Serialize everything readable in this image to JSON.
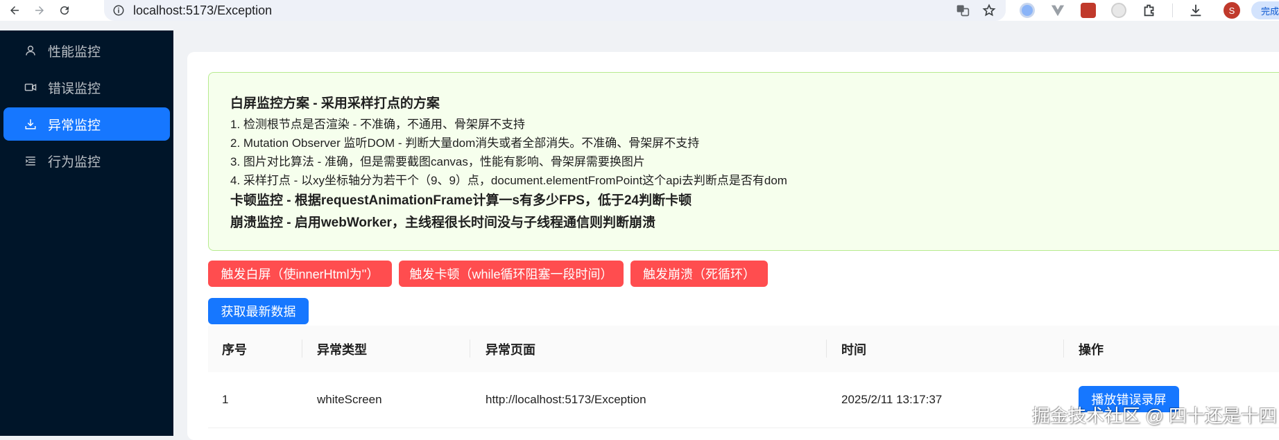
{
  "browser": {
    "url": "localhost:5173/Exception",
    "avatar_letter": "S",
    "finish_label": "完成"
  },
  "sidebar": {
    "items": [
      {
        "label": "性能监控",
        "icon": "user-icon",
        "active": false
      },
      {
        "label": "错误监控",
        "icon": "video-camera-icon",
        "active": false
      },
      {
        "label": "异常监控",
        "icon": "upload-icon",
        "active": true
      },
      {
        "label": "行为监控",
        "icon": "list-icon",
        "active": false
      }
    ]
  },
  "alert": {
    "title1": "白屏监控方案 - 采用采样打点的方案",
    "line1": "1. 检测根节点是否渲染 - 不准确，不通用、骨架屏不支持",
    "line2": "2. Mutation Observer 监听DOM - 判断大量dom消失或者全部消失。不准确、骨架屏不支持",
    "line3": "3. 图片对比算法 - 准确，但是需要截图canvas，性能有影响、骨架屏需要换图片",
    "line4": "4. 采样打点 - 以xy坐标轴分为若干个（9、9）点，document.elementFromPoint这个api去判断点是否有dom",
    "title2": "卡顿监控 - 根据requestAnimationFrame计算一s有多少FPS，低于24判断卡顿",
    "title3": "崩溃监控 - 启用webWorker，主线程很长时间没与子线程通信则判断崩溃"
  },
  "actions": {
    "white_screen": "触发白屏（使innerHtml为''）",
    "lag": "触发卡顿（while循环阻塞一段时间）",
    "crash": "触发崩溃（死循环）",
    "fetch": "获取最新数据"
  },
  "table": {
    "columns": [
      "序号",
      "异常类型",
      "异常页面",
      "时间",
      "操作"
    ],
    "rows": [
      {
        "index": "1",
        "type": "whiteScreen",
        "page": "http://localhost:5173/Exception",
        "time": "2025/2/11 13:17:37",
        "action": "播放错误录屏"
      }
    ]
  },
  "watermark": "掘金技术社区 @ 四十还是十四",
  "colors": {
    "sidebar_bg": "#001529",
    "primary": "#1677ff",
    "danger": "#ff4d4f",
    "alert_bg": "#f6ffed",
    "alert_border": "#b7eb8f"
  }
}
